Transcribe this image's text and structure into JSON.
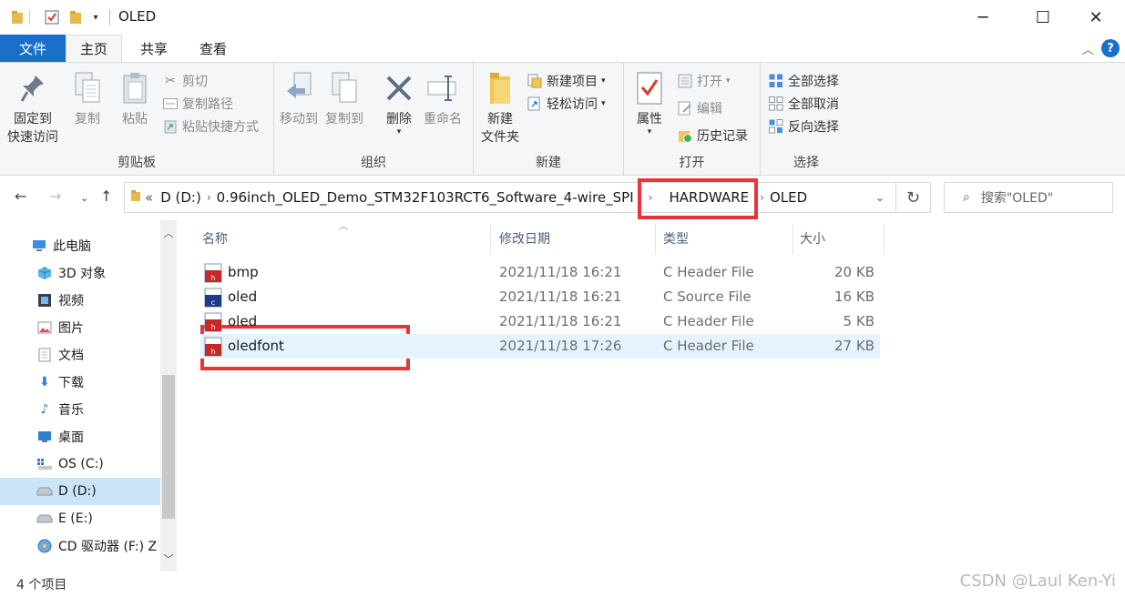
{
  "window": {
    "title": "OLED",
    "controls": {
      "minimize": "─",
      "maximize": "☐",
      "close": "✕"
    }
  },
  "ribbon_tabs": [
    {
      "label": "文件"
    },
    {
      "label": "主页"
    },
    {
      "label": "共享"
    },
    {
      "label": "查看"
    }
  ],
  "ribbon": {
    "clipboard": {
      "label": "剪贴板",
      "pin_line1": "固定到",
      "pin_line2": "快速访问",
      "copy": "复制",
      "paste": "粘贴",
      "cut": "剪切",
      "copy_path": "复制路径",
      "paste_shortcut": "粘贴快捷方式"
    },
    "organize": {
      "label": "组织",
      "move_to": "移动到",
      "copy_to": "复制到",
      "delete": "删除",
      "rename": "重命名"
    },
    "new": {
      "label": "新建",
      "new_folder_line1": "新建",
      "new_folder_line2": "文件夹",
      "new_item": "新建项目",
      "easy_access": "轻松访问"
    },
    "open": {
      "label": "打开",
      "properties": "属性",
      "open": "打开",
      "edit": "编辑",
      "history": "历史记录"
    },
    "select": {
      "label": "选择",
      "select_all": "全部选择",
      "select_none": "全部取消",
      "invert": "反向选择"
    }
  },
  "address": {
    "overflow": "«",
    "crumbs": [
      "D (D:)",
      "0.96inch_OLED_Demo_STM32F103RCT6_Software_4-wire_SPI",
      "HARDWARE",
      "OLED"
    ],
    "search_placeholder": "搜索\"OLED\""
  },
  "nav_pane": [
    {
      "label": "此电脑",
      "icon": "computer-icon"
    },
    {
      "label": "3D 对象",
      "icon": "cube-icon"
    },
    {
      "label": "视频",
      "icon": "video-icon"
    },
    {
      "label": "图片",
      "icon": "picture-icon"
    },
    {
      "label": "文档",
      "icon": "document-icon"
    },
    {
      "label": "下载",
      "icon": "download-icon"
    },
    {
      "label": "音乐",
      "icon": "music-icon"
    },
    {
      "label": "桌面",
      "icon": "desktop-icon"
    },
    {
      "label": "OS (C:)",
      "icon": "drive-icon"
    },
    {
      "label": "D (D:)",
      "icon": "drive-icon",
      "selected": true
    },
    {
      "label": "E (E:)",
      "icon": "drive-icon"
    },
    {
      "label": "CD 驱动器 (F:) Z",
      "icon": "cd-drive-icon"
    }
  ],
  "columns": {
    "name": "名称",
    "date": "修改日期",
    "type": "类型",
    "size": "大小"
  },
  "files": [
    {
      "name": "bmp",
      "date": "2021/11/18 16:21",
      "type": "C Header File",
      "size": "20 KB",
      "kind": "h"
    },
    {
      "name": "oled",
      "date": "2021/11/18 16:21",
      "type": "C Source File",
      "size": "16 KB",
      "kind": "c"
    },
    {
      "name": "oled",
      "date": "2021/11/18 16:21",
      "type": "C Header File",
      "size": "5 KB",
      "kind": "h"
    },
    {
      "name": "oledfont",
      "date": "2021/11/18 17:26",
      "type": "C Header File",
      "size": "27 KB",
      "kind": "h",
      "selected": true
    }
  ],
  "status": {
    "item_count": "4 个项目",
    "watermark": "CSDN @Laul Ken-Yi"
  },
  "colors": {
    "accent": "#1a6fc9",
    "highlight_box": "#e8343a",
    "selection": "#e5f3ff"
  }
}
